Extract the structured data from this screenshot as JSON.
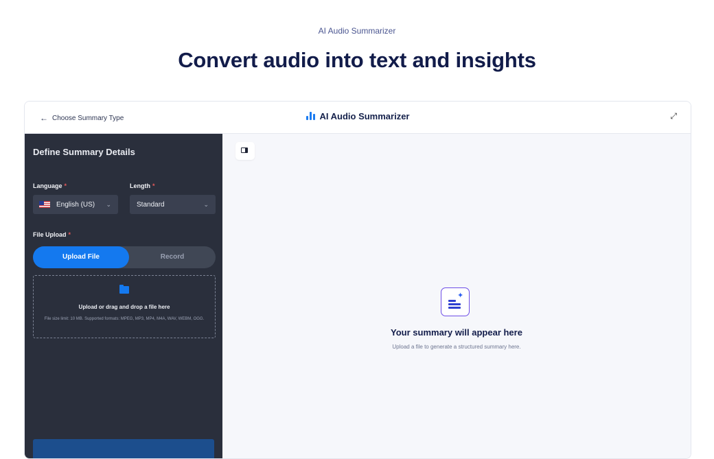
{
  "page": {
    "eyebrow": "AI Audio Summarizer",
    "headline": "Convert audio into text and insights"
  },
  "topbar": {
    "back_label": "Choose Summary Type",
    "back_icon": "arrow-left-icon",
    "app_title": "AI Audio Summarizer",
    "logo_icon": "audio-bars-icon",
    "expand_icon": "expand-icon"
  },
  "sidebar": {
    "title": "Define Summary Details",
    "language": {
      "label": "Language",
      "required_mark": "*",
      "value": "English (US)",
      "flag_icon": "us-flag-icon"
    },
    "length": {
      "label": "Length",
      "required_mark": "*",
      "value": "Standard"
    },
    "file_upload": {
      "label": "File Upload",
      "required_mark": "*",
      "tabs": [
        {
          "label": "Upload File",
          "active": true
        },
        {
          "label": "Record",
          "active": false
        }
      ],
      "dropzone": {
        "icon": "folder-icon",
        "title": "Upload or drag and drop a file here",
        "subtitle": "File size limit: 10 MB. Supported formats: MPEG, MP3, MP4, M4A, WAV, WEBM, OGG."
      }
    }
  },
  "main": {
    "panel_toggle_icon": "sidebar-toggle-icon",
    "empty_icon": "summary-sparkle-icon",
    "empty_title": "Your summary will appear here",
    "empty_subtitle": "Upload a file to generate a structured summary here."
  },
  "colors": {
    "accent": "#1479ef",
    "sidebar_bg": "#2a2f3c",
    "main_bg": "#f6f7fb",
    "heading": "#121c4a",
    "required": "#e55a5a"
  }
}
